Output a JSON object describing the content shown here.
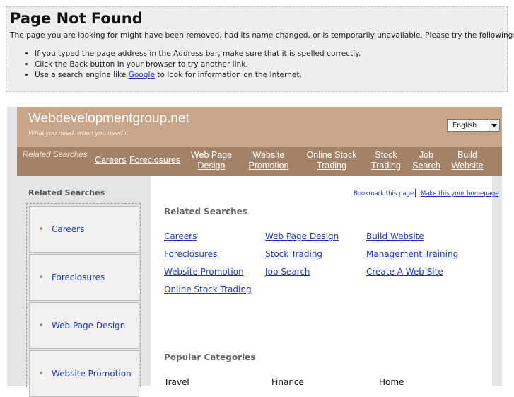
{
  "error": {
    "title": "Page Not Found",
    "message": "The page you are looking for might have been removed, had its name changed, or is temporarily unavailable. Please try the following:",
    "bullets": {
      "b1": "If you typed the page address in the Address bar, make sure that it is spelled correctly.",
      "b2": "Click the Back button in your browser to try another link.",
      "b3_pre": "Use a search engine like ",
      "b3_link": "Google",
      "b3_post": " to look for information on the Internet."
    }
  },
  "site": {
    "name": "Webdevelopmentgroup.net",
    "tagline": "What you need, when you need it",
    "language": "English"
  },
  "nav": {
    "label": "Related Searches",
    "items": [
      "Careers",
      "Foreclosures",
      "Web Page Design",
      "Website Promotion",
      "Online Stock Trading",
      "Stock Trading",
      "Job Search",
      "Build Website"
    ]
  },
  "sidebar": {
    "title": "Related Searches",
    "items": [
      "Careers",
      "Foreclosures",
      "Web Page Design",
      "Website Promotion"
    ]
  },
  "main": {
    "bookmark": "Bookmark this page",
    "homepage": "Make this your homepage",
    "related_title": "Related Searches",
    "related": [
      "Careers",
      "Web Page Design",
      "Build Website",
      "Foreclosures",
      "Stock Trading",
      "Management Training",
      "Website Promotion",
      "Job Search",
      "Create A Web Site",
      "Online Stock Trading"
    ],
    "popular_title": "Popular Categories",
    "popular": [
      "Travel",
      "Finance",
      "Home"
    ]
  },
  "colors": {
    "header": "#c8a488",
    "nav": "#a38268",
    "link": "#1a35c7"
  }
}
